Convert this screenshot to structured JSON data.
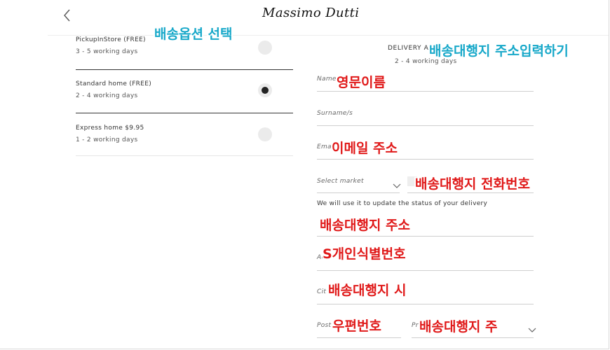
{
  "header": {
    "logo": "Massimo Dutti"
  },
  "colors": {
    "annotation_red": "#e01919",
    "annotation_teal": "#17a8c9",
    "divider": "#333333",
    "radio_selected": "#222222"
  },
  "delivery_options": [
    {
      "name": "PickupInStore (FREE)",
      "days": "3 - 5 working days",
      "selected": false
    },
    {
      "name": "Standard home (FREE)",
      "days": "2 - 4 working days",
      "selected": true
    },
    {
      "name": "Express home $9.95",
      "days": "1 - 2 working days",
      "selected": false
    }
  ],
  "form": {
    "section_title": "DELIVERY A",
    "section_subtitle": "2 - 4 working days",
    "name_label": "Name",
    "surname_label": "Surname/s",
    "email_label": "Emai",
    "market_label": "Select market",
    "phone_hint": "We will use it to update the status of your delivery",
    "address2_label": "Ad",
    "city_label": "Cit",
    "postcode_label": "Post",
    "province_label": "Pr"
  },
  "annotations": {
    "delivery_option_select": "배송옵션 선택",
    "forwarder_address_input": "배송대행지 주소입력하기",
    "english_name": "영문이름",
    "email_address": "이메일 주소",
    "forwarder_phone": "배송대행지 전화번호",
    "forwarder_address": "배송대행지 주소",
    "personal_id": "S개인식별번호",
    "forwarder_city": "배송대행지 시",
    "postal_code": "우편번호",
    "forwarder_state": "배송대행지 주"
  }
}
